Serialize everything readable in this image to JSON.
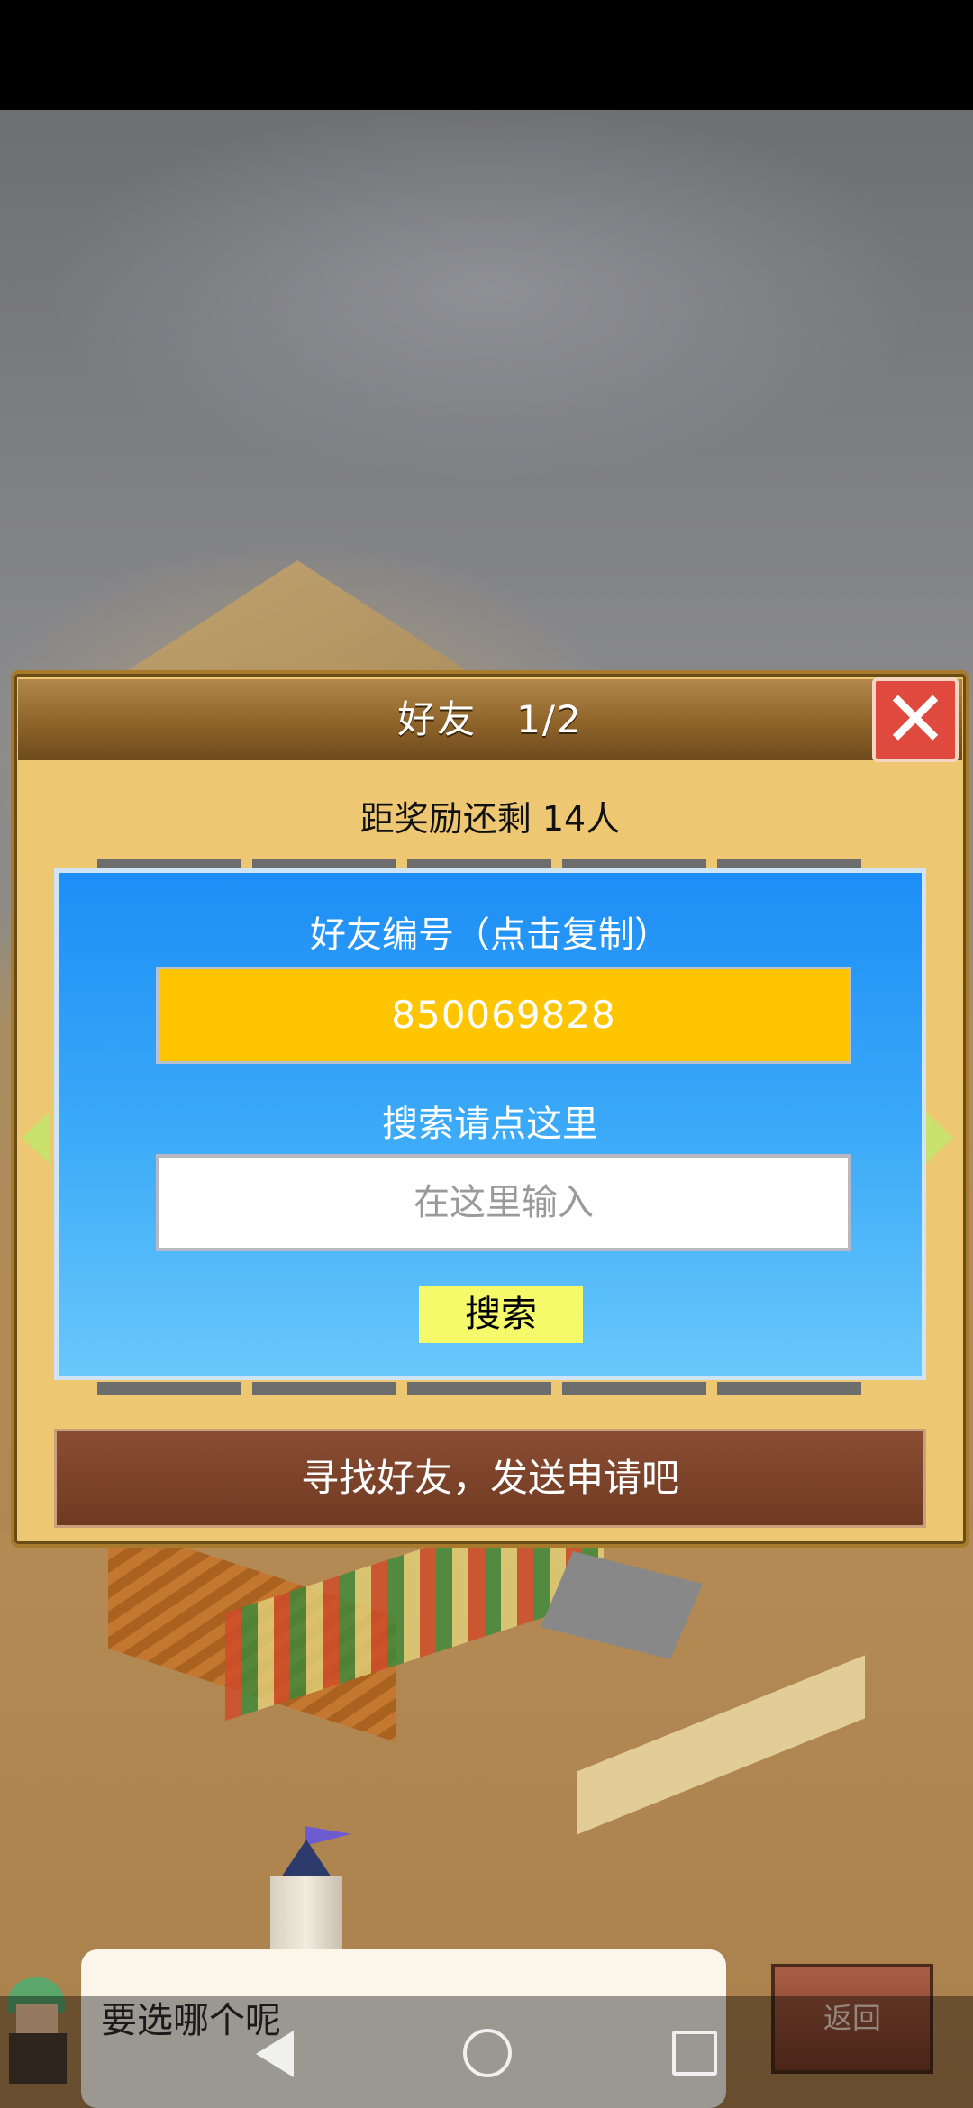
{
  "dialog": {
    "title": "好友　1/2",
    "close_symbol": "✕",
    "reward_remaining": "距奖励还剩 14人",
    "friend_id_label": "好友编号（点击复制）",
    "friend_id": "850069828",
    "search_label": "搜索请点这里",
    "search_placeholder": "在这里输入",
    "search_button": "搜索",
    "send_request": "寻找好友，发送申请吧"
  },
  "hud": {
    "speech": "要选哪个呢",
    "back_button": "返回"
  },
  "icons": {
    "close": "close-icon",
    "prev": "arrow-left-icon",
    "next": "arrow-right-icon",
    "nav_back": "nav-back-icon",
    "nav_home": "nav-home-icon",
    "nav_recent": "nav-recent-icon"
  }
}
